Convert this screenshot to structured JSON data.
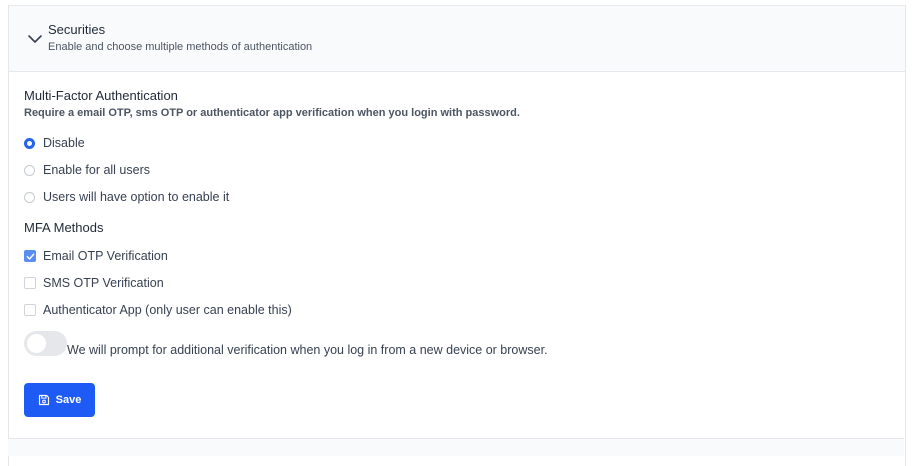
{
  "header": {
    "title": "Securities",
    "subtitle": "Enable and choose multiple methods of authentication",
    "chevron_icon": "chevron-down-icon"
  },
  "mfa": {
    "title": "Multi-Factor Authentication",
    "description": "Require a email OTP, sms OTP or authenticator app verification when you login with password.",
    "options": [
      {
        "label": "Disable",
        "selected": true
      },
      {
        "label": "Enable for all users",
        "selected": false
      },
      {
        "label": "Users will have option to enable it",
        "selected": false
      }
    ]
  },
  "methods": {
    "title": "MFA Methods",
    "items": [
      {
        "label": "Email OTP Verification",
        "checked": true
      },
      {
        "label": "SMS OTP Verification",
        "checked": false
      },
      {
        "label": "Authenticator App (only user can enable this)",
        "checked": false
      }
    ]
  },
  "device_prompt": {
    "label": "We will prompt for additional verification when you log in from a new device or browser.",
    "enabled": false
  },
  "actions": {
    "save_label": "Save",
    "save_icon": "save-icon"
  },
  "colors": {
    "accent": "#1e5bf5",
    "checkbox_checked": "#5b8ef0"
  }
}
